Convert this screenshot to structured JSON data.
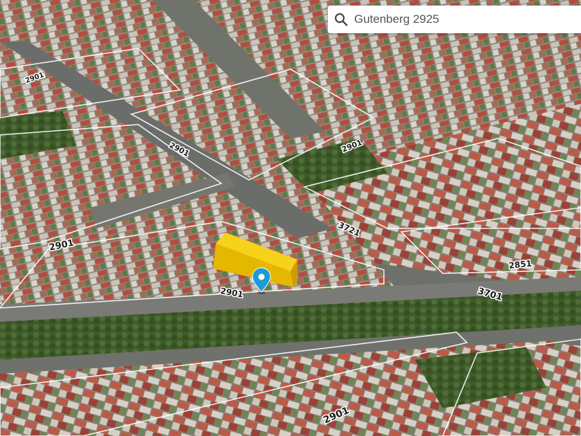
{
  "search": {
    "value": "Gutenberg 2925",
    "icon": "search-icon"
  },
  "map": {
    "type": "satellite-3d",
    "parcel_labels": [
      "2901",
      "2901",
      "2901",
      "2901",
      "3721",
      "2851",
      "3701",
      "2901",
      "2901"
    ],
    "highlighted_building_color": "#f2c200",
    "pin_color": "#1e9ad6",
    "pin_icon": "location-pin-icon"
  }
}
